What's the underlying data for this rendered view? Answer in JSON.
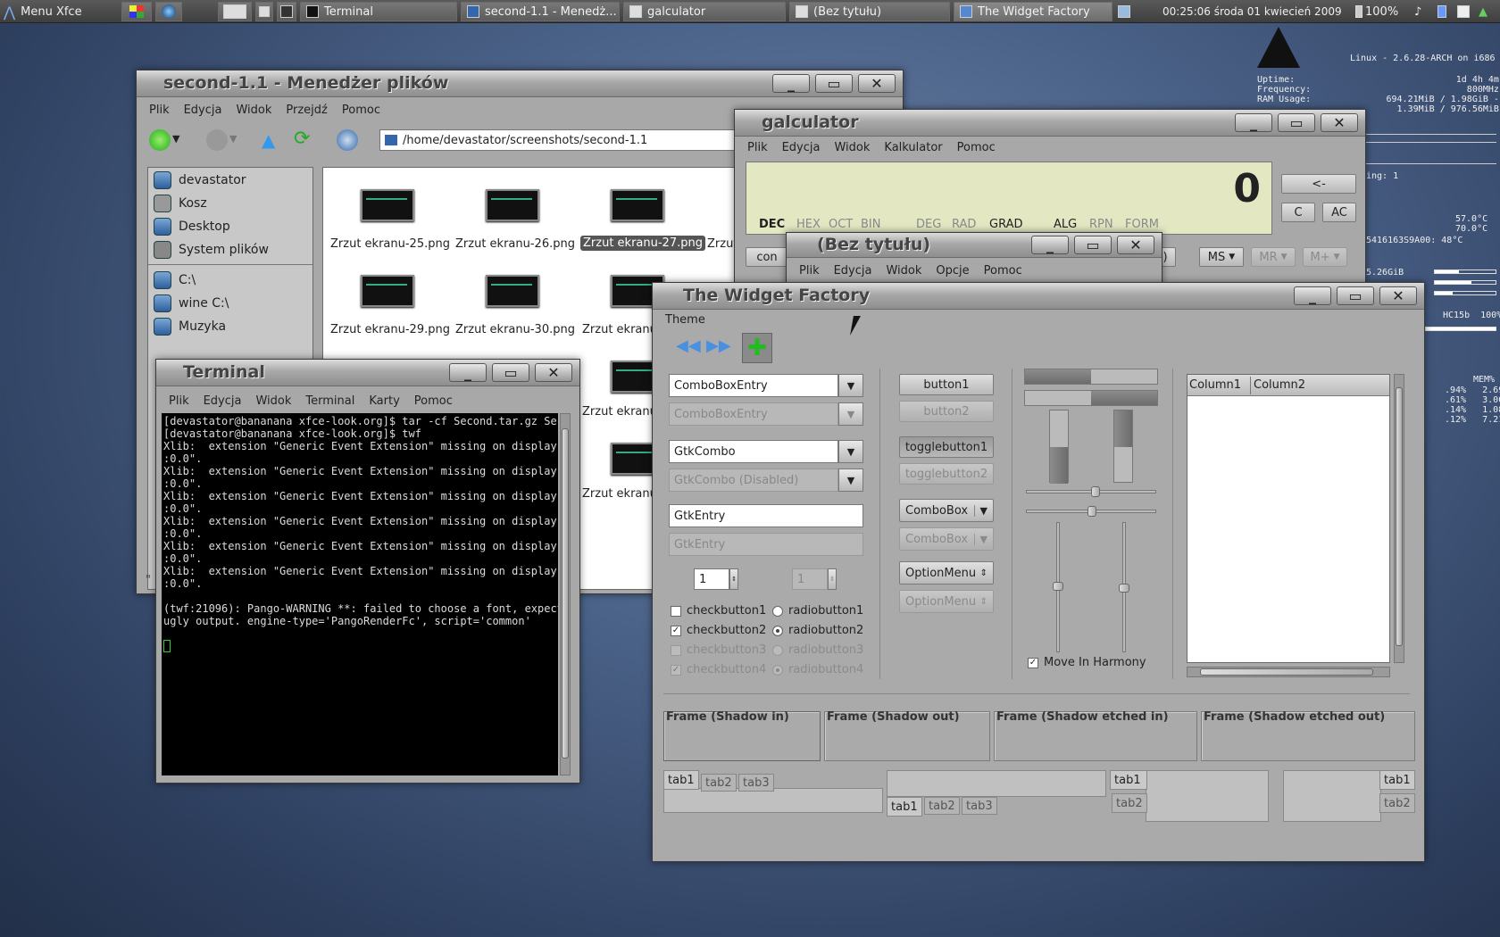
{
  "panel": {
    "menu_label": "Menu Xfce",
    "tasks": [
      {
        "label": "Terminal"
      },
      {
        "label": "second-1.1 - Menedż..."
      },
      {
        "label": "galculator"
      },
      {
        "label": "(Bez tytułu)"
      },
      {
        "label": "The Widget Factory"
      }
    ],
    "clock": "00:25:06  środa 01 kwiecień 2009",
    "battery": "100%"
  },
  "conky": {
    "kernel": "Linux - 2.6.28-ARCH on i686",
    "stats": "Uptime:                              1d 4h 4m\nFrequency:                             800MHz\nRAM Usage:              694.21MiB / 1.98GiB - 34%\n                          1.39MiB / 976.56MiB - 0%",
    "ing": "ing: 1",
    "temps": "57.0°C\n70.0°C",
    "hdd": "5416163S9A00: 48°C",
    "disk": "5.26GiB",
    "host": "HC15b  100%",
    "mem_header": "MEM%",
    "procs": ".94%   2.69\n.61%   3.00\n.14%   1.08\n.12%   7.21"
  },
  "filemanager": {
    "title": "second-1.1 - Menedżer plików",
    "menus": [
      "Plik",
      "Edycja",
      "Widok",
      "Przejdź",
      "Pomoc"
    ],
    "path": "/home/devastator/screenshots/second-1.1",
    "places": [
      "devastator",
      "Kosz",
      "Desktop",
      "System plików"
    ],
    "devices": [
      "C:\\",
      "wine C:\\",
      "Muzyka"
    ],
    "files_row1": [
      "Zrzut ekranu-25.png",
      "Zrzut ekranu-26.png",
      "Zrzut ekranu-27.png",
      "Zrzut"
    ],
    "files_row2": [
      "Zrzut ekranu-29.png",
      "Zrzut ekranu-30.png",
      "Zrzut ekranu"
    ],
    "files_row3": [
      "Zrzut ekranu"
    ],
    "files_row4": [
      "Zrzut ekranu"
    ],
    "status": "\""
  },
  "terminal": {
    "title": "Terminal",
    "menus": [
      "Plik",
      "Edycja",
      "Widok",
      "Terminal",
      "Karty",
      "Pomoc"
    ],
    "output": "[devastator@bananana xfce-look.org]$ tar -cf Second.tar.gz Seco\n[devastator@bananana xfce-look.org]$ twf\nXlib:  extension \"Generic Event Extension\" missing on display \"\n:0.0\".\nXlib:  extension \"Generic Event Extension\" missing on display \"\n:0.0\".\nXlib:  extension \"Generic Event Extension\" missing on display \"\n:0.0\".\nXlib:  extension \"Generic Event Extension\" missing on display \"\n:0.0\".\nXlib:  extension \"Generic Event Extension\" missing on display \"\n:0.0\".\nXlib:  extension \"Generic Event Extension\" missing on display \"\n:0.0\".\n\n(twf:21096): Pango-WARNING **: failed to choose a font, expect\nugly output. engine-type='PangoRenderFc', script='common'"
  },
  "galculator": {
    "title": "galculator",
    "menus": [
      "Plik",
      "Edycja",
      "Widok",
      "Kalkulator",
      "Pomoc"
    ],
    "display": "0",
    "modes": [
      "DEC",
      "HEX",
      "OCT",
      "BIN",
      "DEG",
      "RAD",
      "GRAD",
      "ALG",
      "RPN",
      "FORM"
    ],
    "backspace": "<-",
    "clear": "C",
    "allclear": "AC",
    "con": "con",
    "paren": ")",
    "ms": "MS",
    "mr": "MR",
    "mplus": "M+"
  },
  "beztytulu": {
    "title": "(Bez tytułu)",
    "menus": [
      "Plik",
      "Edycja",
      "Widok",
      "Opcje",
      "Pomoc"
    ]
  },
  "widgetfactory": {
    "title": "The Widget Factory",
    "menu": "Theme",
    "combo1": "ComboBoxEntry",
    "combo1_dis": "ComboBoxEntry",
    "gtkcombo": "GtkCombo",
    "gtkcombo_dis": "GtkCombo (Disabled)",
    "entry": "GtkEntry",
    "entry_dis": "GtkEntry",
    "spin": "1",
    "spin_dis": "1",
    "checks": [
      "checkbutton1",
      "checkbutton2",
      "checkbutton3",
      "checkbutton4"
    ],
    "radios": [
      "radiobutton1",
      "radiobutton2",
      "radiobutton3",
      "radiobutton4"
    ],
    "button1": "button1",
    "button2": "button2",
    "toggle1": "togglebutton1",
    "toggle2": "togglebutton2",
    "combobox": "ComboBox",
    "combobox_dis": "ComboBox",
    "optionmenu": "OptionMenu",
    "optionmenu_dis": "OptionMenu",
    "harmony": "Move In Harmony",
    "col1": "Column1",
    "col2": "Column2",
    "frames": [
      "Frame (Shadow in)",
      "Frame (Shadow out)",
      "Frame (Shadow etched in)",
      "Frame (Shadow etched out)"
    ],
    "tabs": [
      "tab1",
      "tab2",
      "tab3"
    ]
  }
}
